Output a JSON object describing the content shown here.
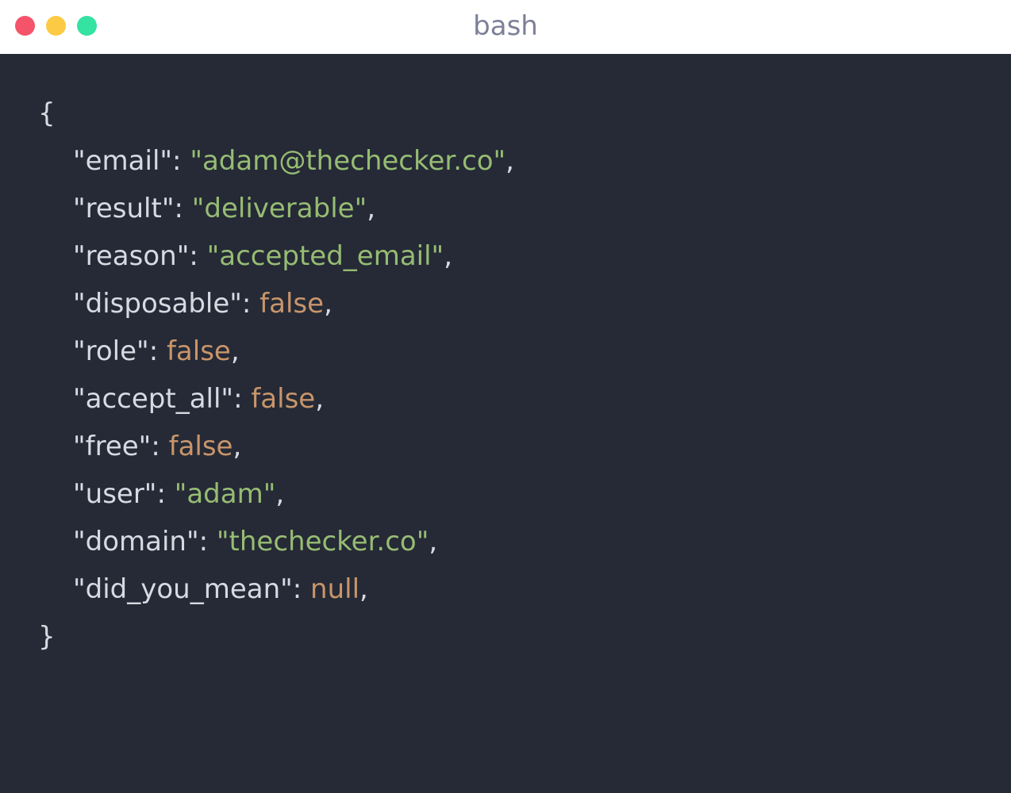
{
  "window": {
    "title": "bash",
    "controls": {
      "close_color": "#f5536a",
      "minimize_color": "#fcca45",
      "maximize_color": "#34e2a2"
    }
  },
  "colors": {
    "background": "#252a36",
    "key_text": "#d8dae2",
    "string_value": "#97bc73",
    "literal_value": "#c9956a"
  },
  "json": {
    "open_brace": "{",
    "close_brace": "}",
    "entries": [
      {
        "key": "\"email\"",
        "value": "\"adam@thechecker.co\"",
        "kind": "string"
      },
      {
        "key": "\"result\"",
        "value": "\"deliverable\"",
        "kind": "string"
      },
      {
        "key": "\"reason\"",
        "value": "\"accepted_email\"",
        "kind": "string"
      },
      {
        "key": "\"disposable\"",
        "value": "false",
        "kind": "literal"
      },
      {
        "key": "\"role\"",
        "value": "false",
        "kind": "literal"
      },
      {
        "key": "\"accept_all\"",
        "value": "false",
        "kind": "literal"
      },
      {
        "key": "\"free\"",
        "value": "false",
        "kind": "literal"
      },
      {
        "key": "\"user\"",
        "value": "\"adam\"",
        "kind": "string"
      },
      {
        "key": "\"domain\"",
        "value": "\"thechecker.co\"",
        "kind": "string"
      },
      {
        "key": "\"did_you_mean\"",
        "value": "null",
        "kind": "literal"
      }
    ]
  }
}
